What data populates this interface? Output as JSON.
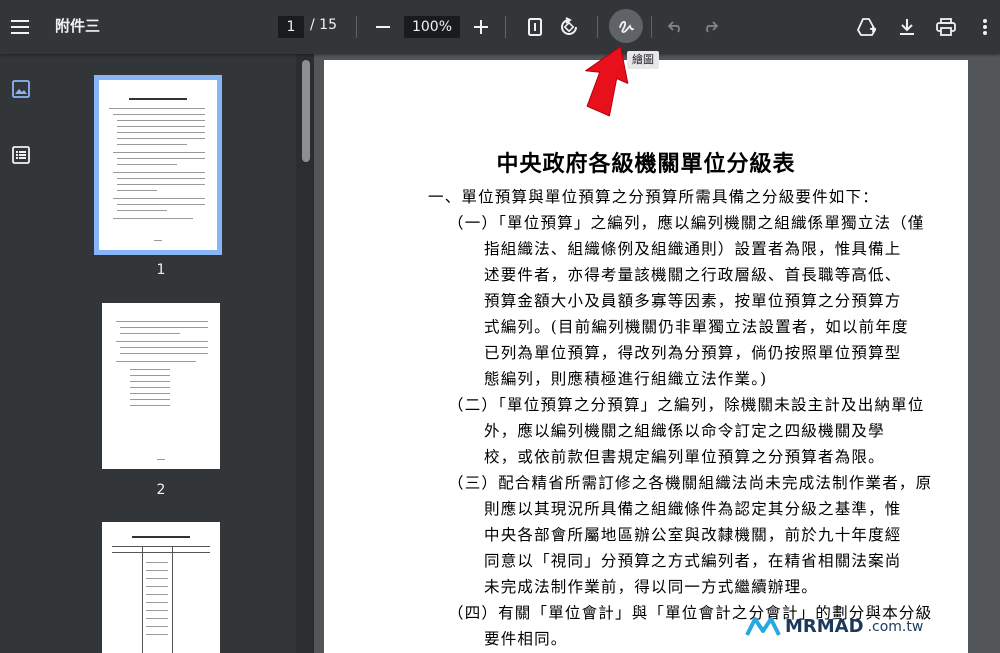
{
  "toolbar": {
    "title": "附件三",
    "current_page": "1",
    "page_count": "/ 15",
    "zoom": "100%",
    "draw_tooltip": "繪圖"
  },
  "thumbnails": [
    {
      "number": "1",
      "selected": true
    },
    {
      "number": "2",
      "selected": false
    }
  ],
  "document": {
    "title": "中央政府各級機關單位分級表",
    "lines": [
      "一、單位預算與單位預算之分預算所需具備之分級要件如下：",
      "（一）「單位預算」之編列，應以編列機關之組織係單獨立法（僅",
      "指組織法、組織條例及組織通則）設置者為限，惟具備上",
      "述要件者，亦得考量該機關之行政層級、首長職等高低、",
      "預算金額大小及員額多寡等因素，按單位預算之分預算方",
      "式編列。(目前編列機關仍非單獨立法設置者，如以前年度",
      "已列為單位預算，得改列為分預算，倘仍按照單位預算型",
      "態編列，則應積極進行組織立法作業。)",
      "（二）「單位預算之分預算」之編列，除機關未設主計及出納單位",
      "外，應以編列機關之組織係以命令訂定之四級機關及學",
      "校，或依前款但書規定編列單位預算之分預算者為限。",
      "（三）配合精省所需訂修之各機關組織法尚未完成法制作業者，原",
      "則應以其現況所具備之組織條件為認定其分級之基準，惟",
      "中央各部會所屬地區辦公室與改隸機關，前於九十年度經",
      "同意以「視同」分預算之方式編列者，在精省相關法案尚",
      "未完成法制作業前，得以同一方式繼續辦理。",
      "（四）有關「單位會計」與「單位會計之分會計」的劃分與本分級",
      "要件相同。"
    ]
  },
  "watermark": {
    "brand": "MRMAD",
    "domain": ".com.tw"
  }
}
